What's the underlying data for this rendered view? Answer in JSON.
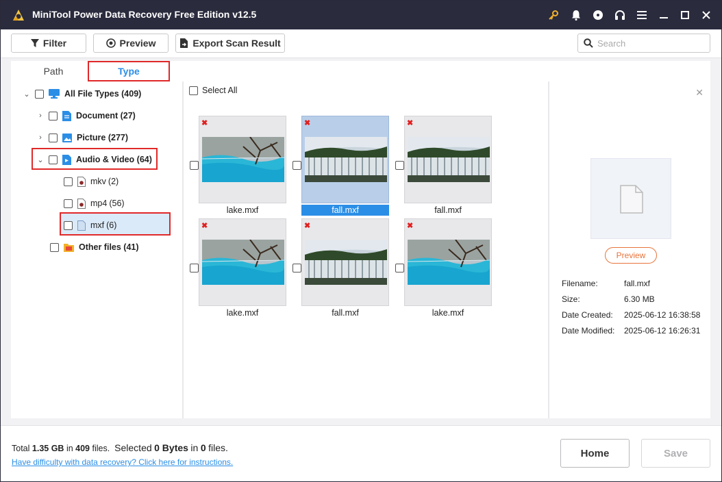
{
  "app": {
    "title": "MiniTool Power Data Recovery Free Edition v12.5"
  },
  "titlebar_icons": [
    "key-icon",
    "bell-icon",
    "disc-icon",
    "headphones-icon",
    "menu-icon",
    "minimize-icon",
    "maximize-icon",
    "close-icon"
  ],
  "toolbar": {
    "filter_label": "Filter",
    "preview_label": "Preview",
    "export_label": "Export Scan Result",
    "search_placeholder": "Search"
  },
  "tabs": {
    "path_label": "Path",
    "type_label": "Type",
    "active": "Type"
  },
  "tree": {
    "all": {
      "label": "All File Types (409)"
    },
    "document": {
      "label": "Document (27)"
    },
    "picture": {
      "label": "Picture (277)"
    },
    "audio_video": {
      "label": "Audio & Video (64)"
    },
    "mkv": {
      "label": "mkv",
      "count": "(2)"
    },
    "mp4": {
      "label": "mp4",
      "count": "(56)"
    },
    "mxf": {
      "label": "mxf",
      "count": "(6)"
    },
    "other": {
      "label": "Other files (41)"
    }
  },
  "grid": {
    "select_all_label": "Select All",
    "files": [
      {
        "name": "lake.mxf",
        "thumb": "lake",
        "selected": false
      },
      {
        "name": "fall.mxf",
        "thumb": "fall",
        "selected": true
      },
      {
        "name": "fall.mxf",
        "thumb": "fall",
        "selected": false
      },
      {
        "name": "lake.mxf",
        "thumb": "lake",
        "selected": false
      },
      {
        "name": "fall.mxf",
        "thumb": "fall",
        "selected": false
      },
      {
        "name": "lake.mxf",
        "thumb": "lake",
        "selected": false
      }
    ]
  },
  "details": {
    "preview_label": "Preview",
    "filename_key": "Filename:",
    "filename": "fall.mxf",
    "size_key": "Size:",
    "size": "6.30 MB",
    "created_key": "Date Created:",
    "created": "2025-06-12 16:38:58",
    "modified_key": "Date Modified:",
    "modified": "2025-06-12 16:26:31"
  },
  "footer": {
    "total_prefix": "Total",
    "total_size": "1.35 GB",
    "in1": "in",
    "total_files": "409",
    "files1": "files.",
    "selected_prefix": "Selected",
    "selected_size": "0 Bytes",
    "in2": "in",
    "selected_files": "0",
    "files2": "files.",
    "help_link": "Have difficulty with data recovery? Click here for instructions.",
    "home_label": "Home",
    "save_label": "Save"
  },
  "colors": {
    "titlebar": "#2a2b3d",
    "accent": "#2b8ee6",
    "highlight": "#e02828",
    "preview": "#e8733a"
  }
}
